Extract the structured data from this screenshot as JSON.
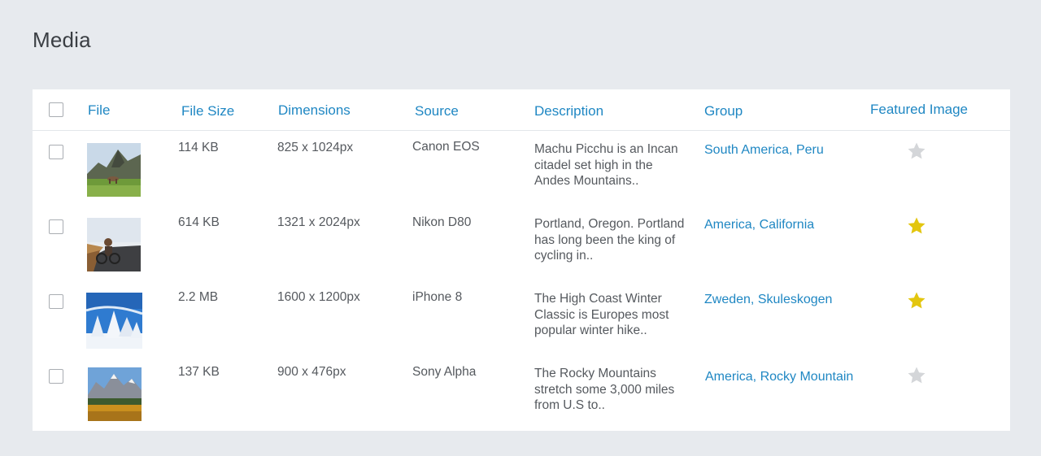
{
  "page": {
    "title": "Media"
  },
  "table": {
    "headers": {
      "file": "File",
      "file_size": "File Size",
      "dimensions": "Dimensions",
      "source": "Source",
      "description": "Description",
      "group": "Group",
      "featured": "Featured Image"
    },
    "rows": [
      {
        "thumbnail": "mountain-landscape-photo",
        "size": "114 KB",
        "dimensions": "825 x 1024px",
        "source": "Canon EOS",
        "description": "Machu Picchu is an Incan citadel set high in the Andes Mountains..",
        "group": "South America, Peru",
        "featured": false
      },
      {
        "thumbnail": "cyclist-on-road-photo",
        "size": "614 KB",
        "dimensions": "1321 x 2024px",
        "source": "Nikon D80",
        "description": "Portland, Oregon. Portland has long been the king of cycling in..",
        "group": "America, California",
        "featured": true
      },
      {
        "thumbnail": "snowy-forest-photo",
        "size": "2.2 MB",
        "dimensions": "1600 x 1200px",
        "source": "iPhone 8",
        "description": "The High Coast Winter Classic is Europes most popular winter hike..",
        "group": "Zweden, Skuleskogen",
        "featured": true
      },
      {
        "thumbnail": "rocky-mountains-autumn-photo",
        "size": "137 KB",
        "dimensions": "900 x 476px",
        "source": "Sony Alpha",
        "description": "The Rocky Mountains stretch some 3,000 miles from U.S to..",
        "group": "America, Rocky Mountain",
        "featured": false
      }
    ]
  },
  "colors": {
    "link": "#1f87c3",
    "star_active": "#e3c60f",
    "star_inactive": "#d4d6d9",
    "background": "#e7eaee"
  }
}
